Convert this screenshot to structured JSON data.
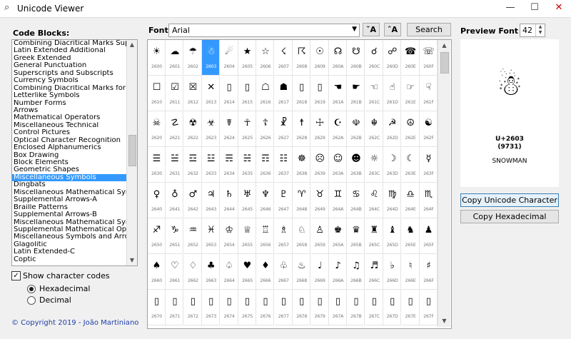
{
  "window": {
    "title": "Unicode Viewer",
    "minimize": "—",
    "maximize": "☐",
    "close": "✕",
    "icon": "magnifier-icon"
  },
  "left": {
    "blocks_label": "Code Blocks:",
    "blocks": [
      "Combining Diacritical Marks Supplement",
      "Latin Extended Additional",
      "Greek Extended",
      "General Punctuation",
      "Superscripts and Subscripts",
      "Currency Symbols",
      "Combining Diacritical Marks for Symbols",
      "Letterlike Symbols",
      "Number Forms",
      "Arrows",
      "Mathematical Operators",
      "Miscellaneous Technical",
      "Control Pictures",
      "Optical Character Recognition",
      "Enclosed Alphanumerics",
      "Box Drawing",
      "Block Elements",
      "Geometric Shapes",
      "Miscellaneous Symbols",
      "Dingbats",
      "Miscellaneous Mathematical Symbols-A",
      "Supplemental Arrows-A",
      "Braille Patterns",
      "Supplemental Arrows-B",
      "Miscellaneous Mathematical Symbols-B",
      "Supplemental Mathematical Operators",
      "Miscellaneous Symbols and Arrows",
      "Glagolitic",
      "Latin Extended-C",
      "Coptic"
    ],
    "selected_block": "Miscellaneous Symbols",
    "show_codes_label": "Show character codes",
    "show_codes_checked": true,
    "hex_label": "Hexadecimal",
    "dec_label": "Decimal",
    "format_selected": "Hexadecimal",
    "copyright": "© Copyright 2019 - João Martiniano"
  },
  "toolbar": {
    "font_label": "Font:",
    "font_value": "Arial",
    "font_smaller": "ˇA",
    "font_larger": "ˆA",
    "search_label": "Search"
  },
  "grid": {
    "rows": [
      [
        "2600",
        "2601",
        "2602",
        "2603",
        "2604",
        "2605",
        "2606",
        "2607",
        "2608",
        "2609",
        "260A",
        "260B",
        "260C",
        "260D",
        "260E",
        "260F"
      ],
      [
        "2610",
        "2611",
        "2612",
        "2613",
        "2614",
        "2615",
        "2616",
        "2617",
        "2618",
        "2619",
        "261A",
        "261B",
        "261C",
        "261D",
        "261E",
        "261F"
      ],
      [
        "2620",
        "2621",
        "2622",
        "2623",
        "2624",
        "2625",
        "2626",
        "2627",
        "2628",
        "2629",
        "262A",
        "262B",
        "262C",
        "262D",
        "262E",
        "262F"
      ],
      [
        "2630",
        "2631",
        "2632",
        "2633",
        "2634",
        "2635",
        "2636",
        "2637",
        "2638",
        "2639",
        "263A",
        "263B",
        "263C",
        "263D",
        "263E",
        "263F"
      ],
      [
        "2640",
        "2641",
        "2642",
        "2643",
        "2644",
        "2645",
        "2646",
        "2647",
        "2648",
        "2649",
        "264A",
        "264B",
        "264C",
        "264D",
        "264E",
        "264F"
      ],
      [
        "2650",
        "2651",
        "2652",
        "2653",
        "2654",
        "2655",
        "2656",
        "2657",
        "2658",
        "2659",
        "265A",
        "265B",
        "265C",
        "265D",
        "265E",
        "265F"
      ],
      [
        "2660",
        "2661",
        "2662",
        "2663",
        "2664",
        "2665",
        "2666",
        "2667",
        "2668",
        "2669",
        "266A",
        "266B",
        "266C",
        "266D",
        "266E",
        "266F"
      ],
      [
        "2670",
        "2671",
        "2672",
        "2673",
        "2674",
        "2675",
        "2676",
        "2677",
        "2678",
        "2679",
        "267A",
        "267B",
        "267C",
        "267D",
        "267E",
        "267F"
      ]
    ],
    "glyphs": [
      [
        "☀",
        "☁",
        "☂",
        "☃",
        "☄",
        "★",
        "☆",
        "☇",
        "☈",
        "☉",
        "☊",
        "☋",
        "☌",
        "☍",
        "☎",
        "☏"
      ],
      [
        "☐",
        "☑",
        "☒",
        "✕",
        "▯",
        "▯",
        "☖",
        "☗",
        "▯",
        "▯",
        "☚",
        "☛",
        "☜",
        "☝",
        "☞",
        "☟"
      ],
      [
        "☠",
        "☡",
        "☢",
        "☣",
        "☤",
        "☥",
        "☦",
        "☧",
        "☨",
        "☩",
        "☪",
        "☫",
        "☬",
        "☭",
        "☮",
        "☯"
      ],
      [
        "☰",
        "☱",
        "☲",
        "☳",
        "☴",
        "☵",
        "☶",
        "☷",
        "☸",
        "☹",
        "☺",
        "☻",
        "☼",
        "☽",
        "☾",
        "☿"
      ],
      [
        "♀",
        "♁",
        "♂",
        "♃",
        "♄",
        "♅",
        "♆",
        "♇",
        "♈",
        "♉",
        "♊",
        "♋",
        "♌",
        "♍",
        "♎",
        "♏"
      ],
      [
        "♐",
        "♑",
        "♒",
        "♓",
        "♔",
        "♕",
        "♖",
        "♗",
        "♘",
        "♙",
        "♚",
        "♛",
        "♜",
        "♝",
        "♞",
        "♟"
      ],
      [
        "♠",
        "♡",
        "♢",
        "♣",
        "♤",
        "♥",
        "♦",
        "♧",
        "♨",
        "♩",
        "♪",
        "♫",
        "♬",
        "♭",
        "♮",
        "♯"
      ],
      [
        "▯",
        "▯",
        "▯",
        "▯",
        "▯",
        "▯",
        "▯",
        "▯",
        "▯",
        "▯",
        "▯",
        "▯",
        "▯",
        "▯",
        "▯",
        "▯"
      ]
    ],
    "selected": "2603"
  },
  "preview": {
    "size_label": "Preview Font Size:",
    "size_value": "42",
    "glyph": "☃",
    "code_hex": "U+2603",
    "code_dec": "(9731)",
    "name": "SNOWMAN",
    "copy_char_label": "Copy Unicode Character",
    "copy_hex_label": "Copy Hexadecimal"
  }
}
